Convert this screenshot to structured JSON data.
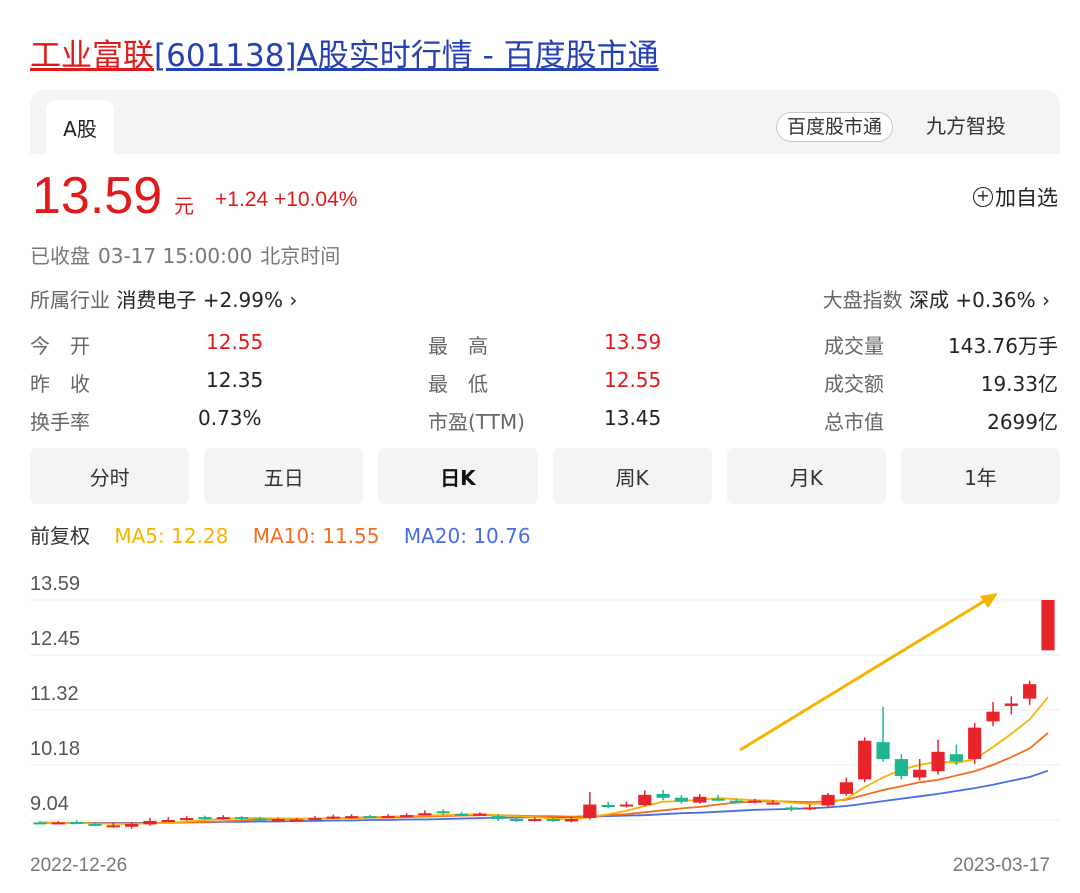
{
  "page_title": {
    "name": "工业富联",
    "rest": "[601138]A股实时行情 - 百度股市通"
  },
  "tabs": {
    "active": "A股"
  },
  "sources": {
    "primary": "百度股市通",
    "secondary": "九方智投"
  },
  "quote": {
    "price": "13.59",
    "unit": "元",
    "change": "+1.24 +10.04%",
    "watch_label": "加自选"
  },
  "status": {
    "state": "已收盘",
    "time": "03-17 15:00:00",
    "zone": "北京时间"
  },
  "industry": {
    "label": "所属行业",
    "value": "消费电子 +2.99% ›"
  },
  "market_index": {
    "label": "大盘指数",
    "value": "深成 +0.36% ›"
  },
  "stats": {
    "open_label": "今　开",
    "open": "12.55",
    "high_label": "最　高",
    "high": "13.59",
    "volume_label": "成交量",
    "volume": "143.76万手",
    "prev_label": "昨　收",
    "prev": "12.35",
    "low_label": "最　低",
    "low": "12.55",
    "amount_label": "成交额",
    "amount": "19.33亿",
    "turnover_label": "换手率",
    "turnover": "0.73%",
    "pe_label": "市盈(TTM)",
    "pe": "13.45",
    "mcap_label": "总市值",
    "mcap": "2699亿"
  },
  "periods": [
    "分时",
    "五日",
    "日K",
    "周K",
    "月K",
    "1年"
  ],
  "active_period": "日K",
  "ma_legend": {
    "adjust": "前复权",
    "ma5": "MA5: 12.28",
    "ma10": "MA10: 11.55",
    "ma20": "MA20: 10.76"
  },
  "colors": {
    "up": "#e8242b",
    "down": "#1fb590",
    "ma5": "#f4b400",
    "ma10": "#f56d1f",
    "ma20": "#4a6ee0",
    "link_red": "#e0191b",
    "link_blue": "#2440b3"
  },
  "chart_data": {
    "type": "candlestick",
    "y_ticks": [
      "13.59",
      "12.45",
      "11.32",
      "10.18",
      "9.04"
    ],
    "ylim": [
      9.04,
      13.59
    ],
    "x_start_label": "2022-12-26",
    "x_end_label": "2023-03-17",
    "candles": [
      {
        "o": 8.99,
        "c": 8.97,
        "h": 9.02,
        "l": 8.95
      },
      {
        "o": 8.98,
        "c": 8.99,
        "h": 9.02,
        "l": 8.96
      },
      {
        "o": 9.0,
        "c": 8.97,
        "h": 9.03,
        "l": 8.95
      },
      {
        "o": 8.96,
        "c": 8.94,
        "h": 8.98,
        "l": 8.92
      },
      {
        "o": 8.9,
        "c": 8.93,
        "h": 8.98,
        "l": 8.88
      },
      {
        "o": 8.9,
        "c": 8.96,
        "h": 9.0,
        "l": 8.86
      },
      {
        "o": 8.95,
        "c": 9.02,
        "h": 9.08,
        "l": 8.92
      },
      {
        "o": 9.03,
        "c": 9.04,
        "h": 9.1,
        "l": 9.0
      },
      {
        "o": 9.05,
        "c": 9.08,
        "h": 9.12,
        "l": 9.03
      },
      {
        "o": 9.1,
        "c": 9.07,
        "h": 9.13,
        "l": 9.04
      },
      {
        "o": 9.08,
        "c": 9.1,
        "h": 9.14,
        "l": 9.05
      },
      {
        "o": 9.1,
        "c": 9.07,
        "h": 9.12,
        "l": 9.04
      },
      {
        "o": 9.07,
        "c": 9.05,
        "h": 9.1,
        "l": 9.03
      },
      {
        "o": 9.04,
        "c": 9.06,
        "h": 9.09,
        "l": 9.02
      },
      {
        "o": 9.05,
        "c": 9.05,
        "h": 9.08,
        "l": 9.02
      },
      {
        "o": 9.06,
        "c": 9.08,
        "h": 9.12,
        "l": 9.04
      },
      {
        "o": 9.08,
        "c": 9.11,
        "h": 9.15,
        "l": 9.06
      },
      {
        "o": 9.1,
        "c": 9.12,
        "h": 9.16,
        "l": 9.08
      },
      {
        "o": 9.12,
        "c": 9.1,
        "h": 9.15,
        "l": 9.08
      },
      {
        "o": 9.1,
        "c": 9.12,
        "h": 9.16,
        "l": 9.08
      },
      {
        "o": 9.12,
        "c": 9.14,
        "h": 9.18,
        "l": 9.1
      },
      {
        "o": 9.17,
        "c": 9.18,
        "h": 9.24,
        "l": 9.14
      },
      {
        "o": 9.22,
        "c": 9.18,
        "h": 9.26,
        "l": 9.14
      },
      {
        "o": 9.17,
        "c": 9.15,
        "h": 9.21,
        "l": 9.13
      },
      {
        "o": 9.16,
        "c": 9.17,
        "h": 9.2,
        "l": 9.13
      },
      {
        "o": 9.12,
        "c": 9.06,
        "h": 9.16,
        "l": 9.02
      },
      {
        "o": 9.06,
        "c": 9.03,
        "h": 9.1,
        "l": 9.0
      },
      {
        "o": 9.03,
        "c": 9.06,
        "h": 9.1,
        "l": 9.01
      },
      {
        "o": 9.06,
        "c": 9.02,
        "h": 9.09,
        "l": 9.0
      },
      {
        "o": 9.01,
        "c": 9.06,
        "h": 9.1,
        "l": 8.99
      },
      {
        "o": 9.08,
        "c": 9.36,
        "h": 9.62,
        "l": 9.05
      },
      {
        "o": 9.35,
        "c": 9.33,
        "h": 9.42,
        "l": 9.28
      },
      {
        "o": 9.33,
        "c": 9.36,
        "h": 9.42,
        "l": 9.3
      },
      {
        "o": 9.35,
        "c": 9.56,
        "h": 9.65,
        "l": 9.32
      },
      {
        "o": 9.58,
        "c": 9.5,
        "h": 9.66,
        "l": 9.45
      },
      {
        "o": 9.5,
        "c": 9.42,
        "h": 9.55,
        "l": 9.38
      },
      {
        "o": 9.4,
        "c": 9.52,
        "h": 9.58,
        "l": 9.38
      },
      {
        "o": 9.48,
        "c": 9.47,
        "h": 9.56,
        "l": 9.43
      },
      {
        "o": 9.44,
        "c": 9.41,
        "h": 9.48,
        "l": 9.38
      },
      {
        "o": 9.41,
        "c": 9.44,
        "h": 9.48,
        "l": 9.38
      },
      {
        "o": 9.4,
        "c": 9.4,
        "h": 9.45,
        "l": 9.36
      },
      {
        "o": 9.3,
        "c": 9.26,
        "h": 9.34,
        "l": 9.22
      },
      {
        "o": 9.27,
        "c": 9.3,
        "h": 9.36,
        "l": 9.24
      },
      {
        "o": 9.34,
        "c": 9.56,
        "h": 9.6,
        "l": 9.3
      },
      {
        "o": 9.58,
        "c": 9.82,
        "h": 9.92,
        "l": 9.54
      },
      {
        "o": 9.88,
        "c": 10.68,
        "h": 10.75,
        "l": 9.82
      },
      {
        "o": 10.65,
        "c": 10.3,
        "h": 11.38,
        "l": 10.25
      },
      {
        "o": 10.3,
        "c": 9.95,
        "h": 10.4,
        "l": 9.88
      },
      {
        "o": 9.92,
        "c": 10.08,
        "h": 10.3,
        "l": 9.86
      },
      {
        "o": 10.05,
        "c": 10.45,
        "h": 10.7,
        "l": 9.98
      },
      {
        "o": 10.4,
        "c": 10.25,
        "h": 10.6,
        "l": 10.18
      },
      {
        "o": 10.3,
        "c": 10.95,
        "h": 11.05,
        "l": 10.2
      },
      {
        "o": 11.08,
        "c": 11.28,
        "h": 11.48,
        "l": 10.98
      },
      {
        "o": 11.4,
        "c": 11.45,
        "h": 11.6,
        "l": 11.22
      },
      {
        "o": 11.55,
        "c": 11.85,
        "h": 11.92,
        "l": 11.42
      },
      {
        "o": 12.55,
        "c": 13.59,
        "h": 13.59,
        "l": 12.55
      }
    ],
    "ma5": [
      8.99,
      8.98,
      8.98,
      8.97,
      8.96,
      8.96,
      8.97,
      8.98,
      9.01,
      9.04,
      9.06,
      9.08,
      9.08,
      9.07,
      9.07,
      9.07,
      9.08,
      9.09,
      9.1,
      9.11,
      9.12,
      9.13,
      9.14,
      9.15,
      9.16,
      9.14,
      9.12,
      9.1,
      9.07,
      9.05,
      9.1,
      9.16,
      9.23,
      9.33,
      9.42,
      9.43,
      9.46,
      9.49,
      9.47,
      9.45,
      9.44,
      9.4,
      9.37,
      9.39,
      9.48,
      9.72,
      9.92,
      10.08,
      10.18,
      10.25,
      10.22,
      10.3,
      10.55,
      10.82,
      11.12,
      11.58
    ],
    "ma10": [
      8.99,
      8.98,
      8.98,
      8.97,
      8.97,
      8.97,
      8.97,
      8.98,
      8.99,
      9.0,
      9.01,
      9.03,
      9.05,
      9.06,
      9.06,
      9.07,
      9.08,
      9.08,
      9.09,
      9.09,
      9.1,
      9.11,
      9.12,
      9.13,
      9.14,
      9.14,
      9.13,
      9.12,
      9.12,
      9.11,
      9.12,
      9.14,
      9.16,
      9.2,
      9.24,
      9.28,
      9.31,
      9.36,
      9.4,
      9.42,
      9.43,
      9.42,
      9.41,
      9.43,
      9.46,
      9.56,
      9.66,
      9.74,
      9.82,
      9.87,
      9.96,
      10.05,
      10.18,
      10.34,
      10.52,
      10.84
    ],
    "ma20": [
      8.98,
      8.98,
      8.98,
      8.98,
      8.98,
      8.98,
      8.98,
      8.98,
      8.99,
      8.99,
      9.0,
      9.0,
      9.01,
      9.01,
      9.02,
      9.02,
      9.03,
      9.03,
      9.04,
      9.04,
      9.05,
      9.05,
      9.06,
      9.07,
      9.08,
      9.09,
      9.09,
      9.1,
      9.1,
      9.1,
      9.11,
      9.12,
      9.13,
      9.14,
      9.16,
      9.18,
      9.19,
      9.21,
      9.23,
      9.25,
      9.26,
      9.27,
      9.28,
      9.3,
      9.33,
      9.38,
      9.43,
      9.48,
      9.53,
      9.58,
      9.64,
      9.7,
      9.77,
      9.85,
      9.93,
      10.06
    ]
  }
}
